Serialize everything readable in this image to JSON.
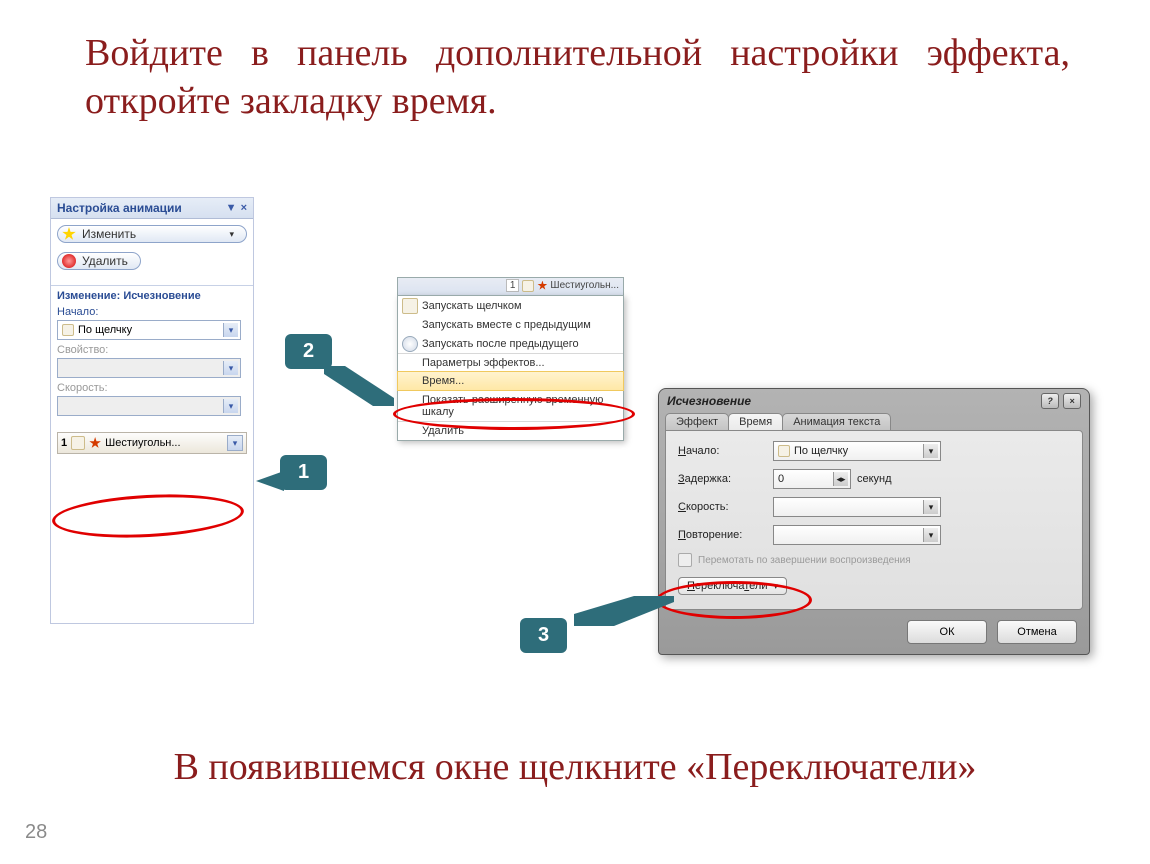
{
  "instruction_top": "Войдите в панель дополнительной настройки эффекта, откройте закладку время.",
  "instruction_bottom": "В появившемся окне щелкните «Переключатели»",
  "slide_number": "28",
  "callouts": {
    "c1": "1",
    "c2": "2",
    "c3": "3"
  },
  "panel1": {
    "title": "Настройка анимации",
    "btn_change": "Изменить",
    "btn_delete": "Удалить",
    "section_hdr": "Изменение: Исчезновение",
    "lbl_start": "Начало:",
    "start_value": "По щелчку",
    "lbl_property": "Свойство:",
    "lbl_speed": "Скорость:",
    "item_index": "1",
    "item_name": "Шестиугольн..."
  },
  "menu_header_item": "Шестиугольн...",
  "menu": [
    "Запускать щелчком",
    "Запускать вместе с предыдущим",
    "Запускать после предыдущего",
    "Параметры эффектов...",
    "Время...",
    "Показать расширенную временную шкалу",
    "Удалить"
  ],
  "dialog": {
    "title": "Исчезновение",
    "tabs": [
      "Эффект",
      "Время",
      "Анимация текста"
    ],
    "lbl_start": "Начало:",
    "start_value": "По щелчку",
    "lbl_delay": "Задержка:",
    "delay_value": "0",
    "delay_unit": "секунд",
    "lbl_speed": "Скорость:",
    "lbl_repeat": "Повторение:",
    "chk_rewind": "Перемотать по завершении воспроизведения",
    "btn_triggers": "Переключатели",
    "btn_ok": "ОК",
    "btn_cancel": "Отмена"
  }
}
